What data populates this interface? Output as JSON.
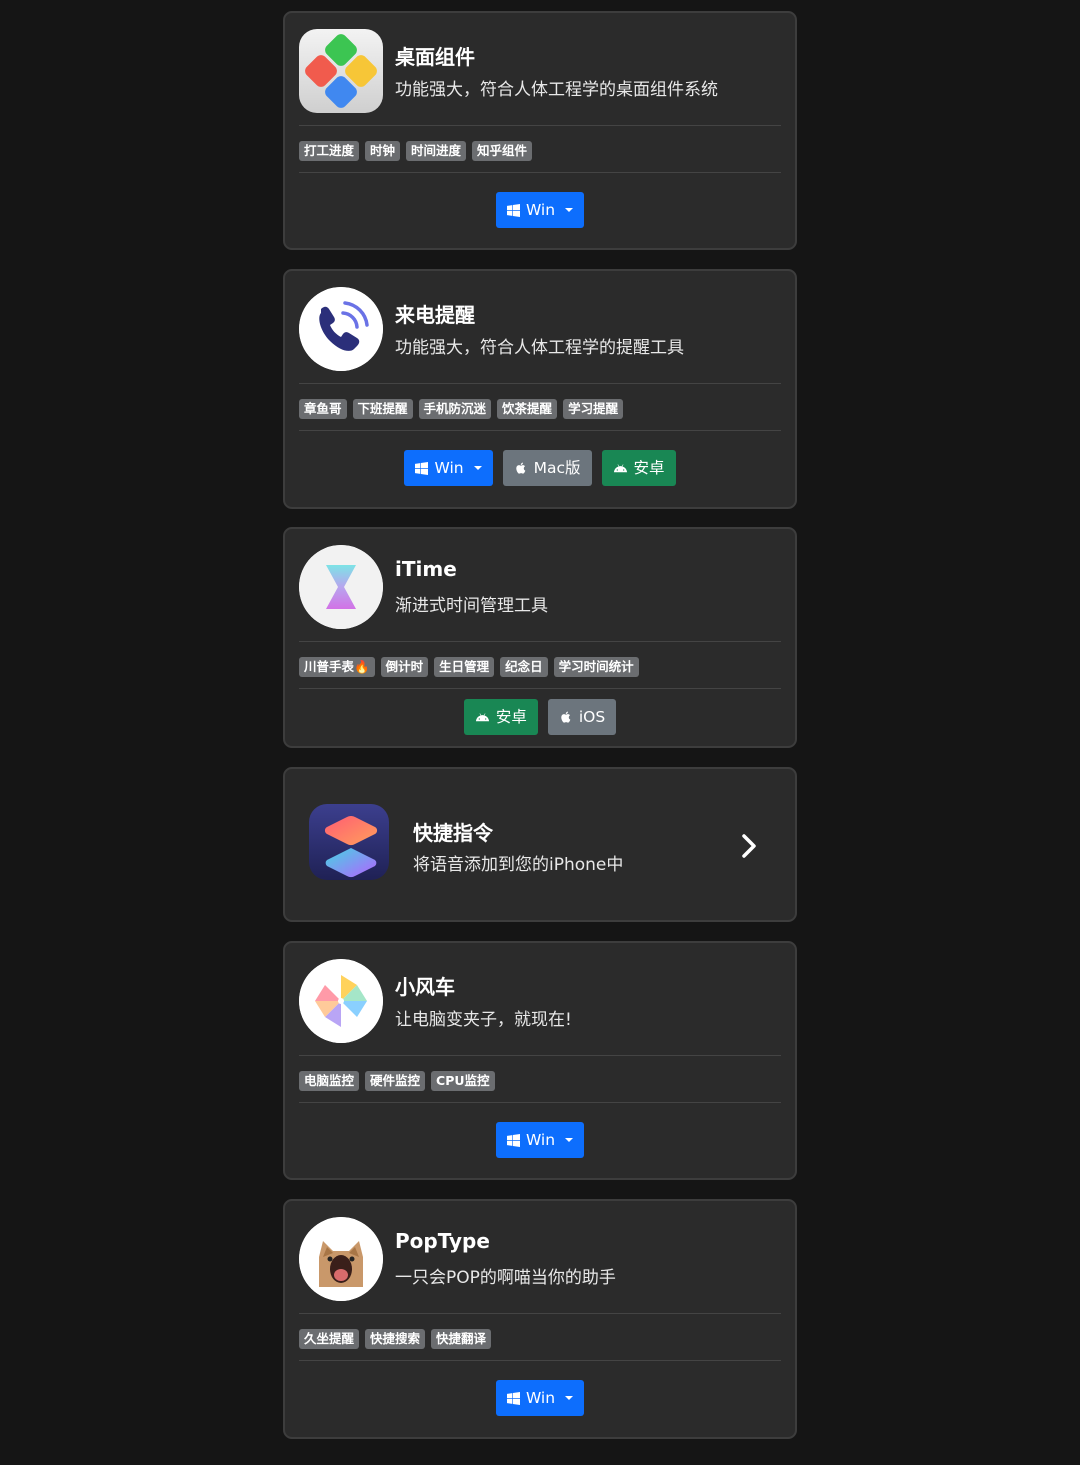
{
  "colors": {
    "page_bg": "#151515",
    "card_bg": "#2b2b2b",
    "card_border": "#3d3d3d",
    "tag_bg": "#6b6d70",
    "win_button": "#0d6efd",
    "mac_button": "#6c757d",
    "android_button": "#198754"
  },
  "cards": [
    {
      "title": "桌面组件",
      "desc": "功能强大，符合人体工程学的桌面组件系统",
      "icon": "four-color-diamonds-icon",
      "tags": [
        "打工进度",
        "时钟",
        "时间进度",
        "知乎组件"
      ],
      "buttons": [
        {
          "label": "Win",
          "icon": "windows-icon",
          "dropdown": true
        }
      ]
    },
    {
      "title": "来电提醒",
      "desc": "功能强大，符合人体工程学的提醒工具",
      "icon": "phone-call-icon",
      "tags": [
        "章鱼哥",
        "下班提醒",
        "手机防沉迷",
        "饮茶提醒",
        "学习提醒"
      ],
      "buttons": [
        {
          "label": "Win",
          "icon": "windows-icon",
          "dropdown": true
        },
        {
          "label": "Mac版",
          "icon": "apple-icon"
        },
        {
          "label": "安卓",
          "icon": "android-icon"
        }
      ]
    },
    {
      "title": "iTime",
      "desc": "渐进式时间管理工具",
      "icon": "hourglass-icon",
      "tags": [
        "川普手表🔥",
        "倒计时",
        "生日管理",
        "纪念日",
        "学习时间统计"
      ],
      "buttons": [
        {
          "label": "安卓",
          "icon": "android-icon"
        },
        {
          "label": "iOS",
          "icon": "apple-icon"
        }
      ]
    },
    {
      "title": "快捷指令",
      "desc": "将语音添加到您的iPhone中",
      "icon": "shortcuts-icon",
      "action": "chevron-right-icon"
    },
    {
      "title": "小风车",
      "desc": "让电脑变夹子，就现在!",
      "icon": "pinwheel-icon",
      "tags": [
        "电脑监控",
        "硬件监控",
        "CPU监控"
      ],
      "buttons": [
        {
          "label": "Win",
          "icon": "windows-icon",
          "dropdown": true
        }
      ]
    },
    {
      "title": "PopType",
      "desc": "一只会POP的啊喵当你的助手",
      "icon": "pop-cat-icon",
      "tags": [
        "久坐提醒",
        "快捷搜索",
        "快捷翻译"
      ],
      "buttons": [
        {
          "label": "Win",
          "icon": "windows-icon",
          "dropdown": true
        }
      ]
    }
  ]
}
